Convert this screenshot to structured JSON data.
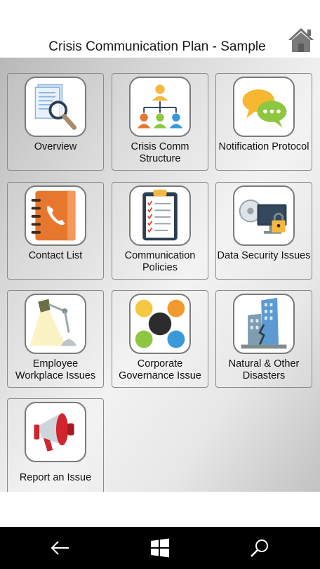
{
  "header": {
    "title": "Crisis Communication Plan - Sample",
    "home_icon": "home-icon"
  },
  "tiles": [
    {
      "label": "Overview",
      "icon": "document-magnifier-icon"
    },
    {
      "label": "Crisis Comm Structure",
      "icon": "org-chart-icon"
    },
    {
      "label": "Notification Protocol",
      "icon": "chat-bubbles-icon"
    },
    {
      "label": "Contact List",
      "icon": "address-book-icon"
    },
    {
      "label": "Communication Policies",
      "icon": "clipboard-checklist-icon"
    },
    {
      "label": "Data Security Issues",
      "icon": "monitor-lock-icon"
    },
    {
      "label": "Employee Workplace Issues",
      "icon": "desk-lamp-icon"
    },
    {
      "label": "Corporate Governance Issue",
      "icon": "colored-circles-icon"
    },
    {
      "label": "Natural & Other Disasters",
      "icon": "damaged-buildings-icon"
    },
    {
      "label": "Report an Issue",
      "icon": "megaphone-icon"
    }
  ],
  "navbar": {
    "back_icon": "back-arrow-icon",
    "start_icon": "windows-start-icon",
    "search_icon": "search-icon"
  }
}
